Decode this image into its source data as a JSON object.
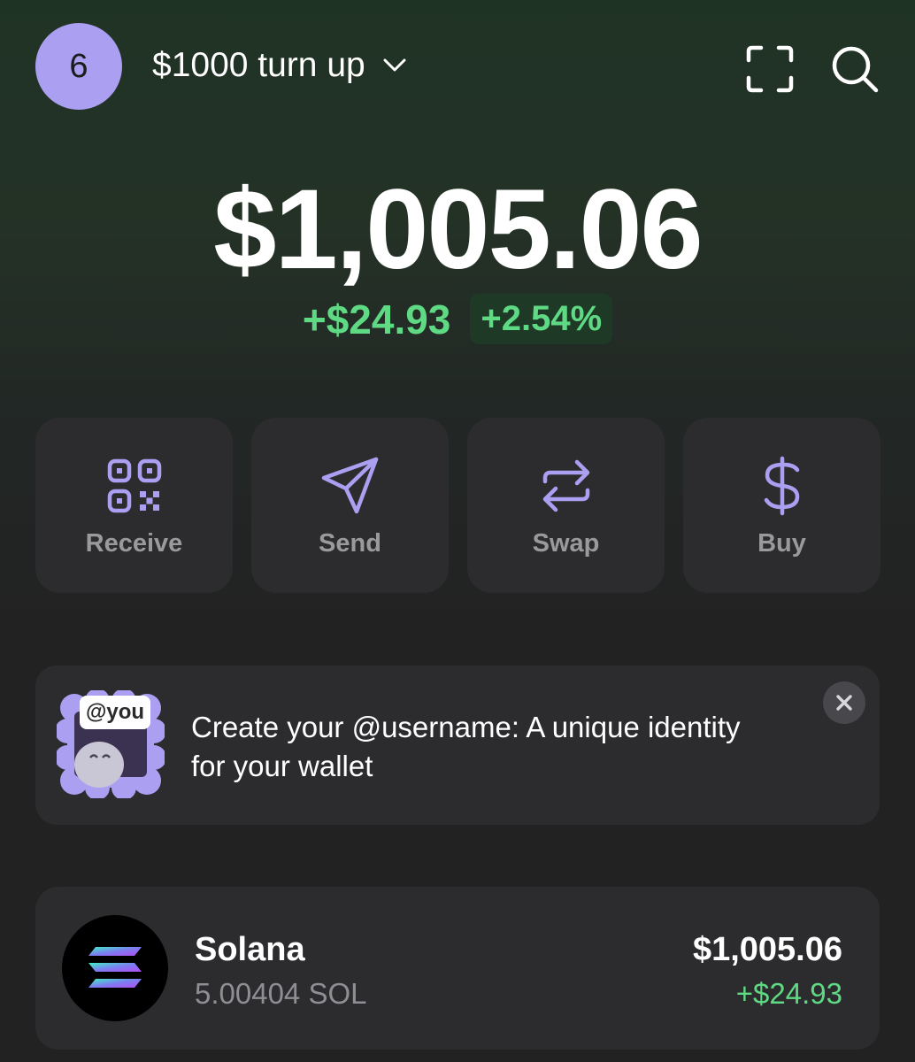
{
  "header": {
    "avatar_label": "6",
    "wallet_name": "$1000 turn up"
  },
  "balance": {
    "total": "$1,005.06",
    "change_abs": "+$24.93",
    "change_pct": "+2.54%"
  },
  "actions": [
    {
      "label": "Receive",
      "icon": "qr-code-icon"
    },
    {
      "label": "Send",
      "icon": "send-icon"
    },
    {
      "label": "Swap",
      "icon": "swap-icon"
    },
    {
      "label": "Buy",
      "icon": "dollar-icon"
    }
  ],
  "promo": {
    "badge": "@you",
    "text": "Create your @username: A unique identity for your wallet"
  },
  "tokens": [
    {
      "name": "Solana",
      "amount": "5.00404 SOL",
      "value": "$1,005.06",
      "change": "+$24.93"
    }
  ],
  "colors": {
    "accent": "#ab9ff2",
    "positive": "#5fd983",
    "card": "#2c2c2f"
  }
}
